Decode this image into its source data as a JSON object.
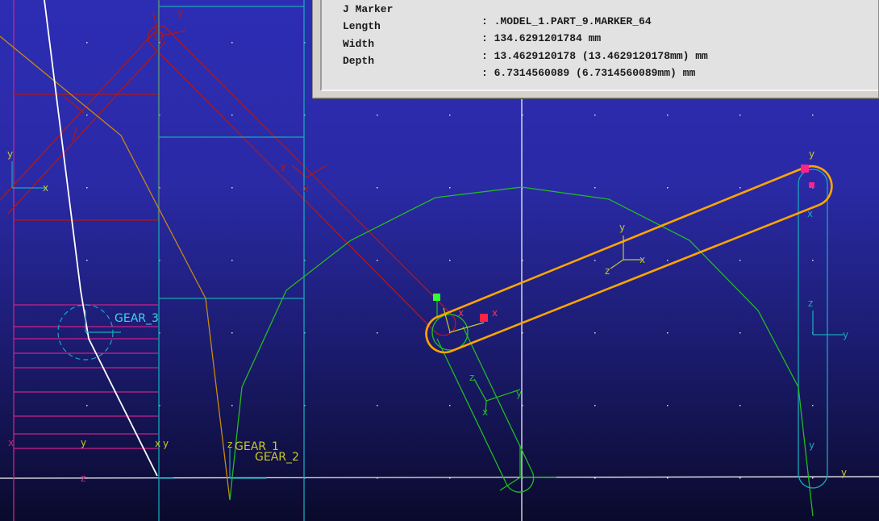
{
  "info_panel": {
    "rows": [
      {
        "key": "J Marker",
        "value": ": .MODEL_1.PART_9.MARKER_64"
      },
      {
        "key": "Length",
        "value": ": 134.6291201784 mm"
      },
      {
        "key": "Width",
        "value": ": 13.4629120178 (13.4629120178mm) mm"
      },
      {
        "key": "Depth",
        "value": ": 6.7314560089 (6.7314560089mm) mm"
      }
    ]
  },
  "labels": {
    "gear_3": "GEAR_3",
    "gear_1": "GEAR_1",
    "gear_2": "GEAR_2"
  },
  "axis_letters": {
    "x": "x",
    "y": "y",
    "z": "z"
  },
  "colors": {
    "background_top": "#2d2db4",
    "background_bottom": "#0a0a2c",
    "link_highlight": "#ffa500",
    "green_wire": "#22bb22",
    "cyan_wire": "#1aa7b8",
    "magenta_wire": "#cc2288",
    "red_wire": "#b01818"
  }
}
